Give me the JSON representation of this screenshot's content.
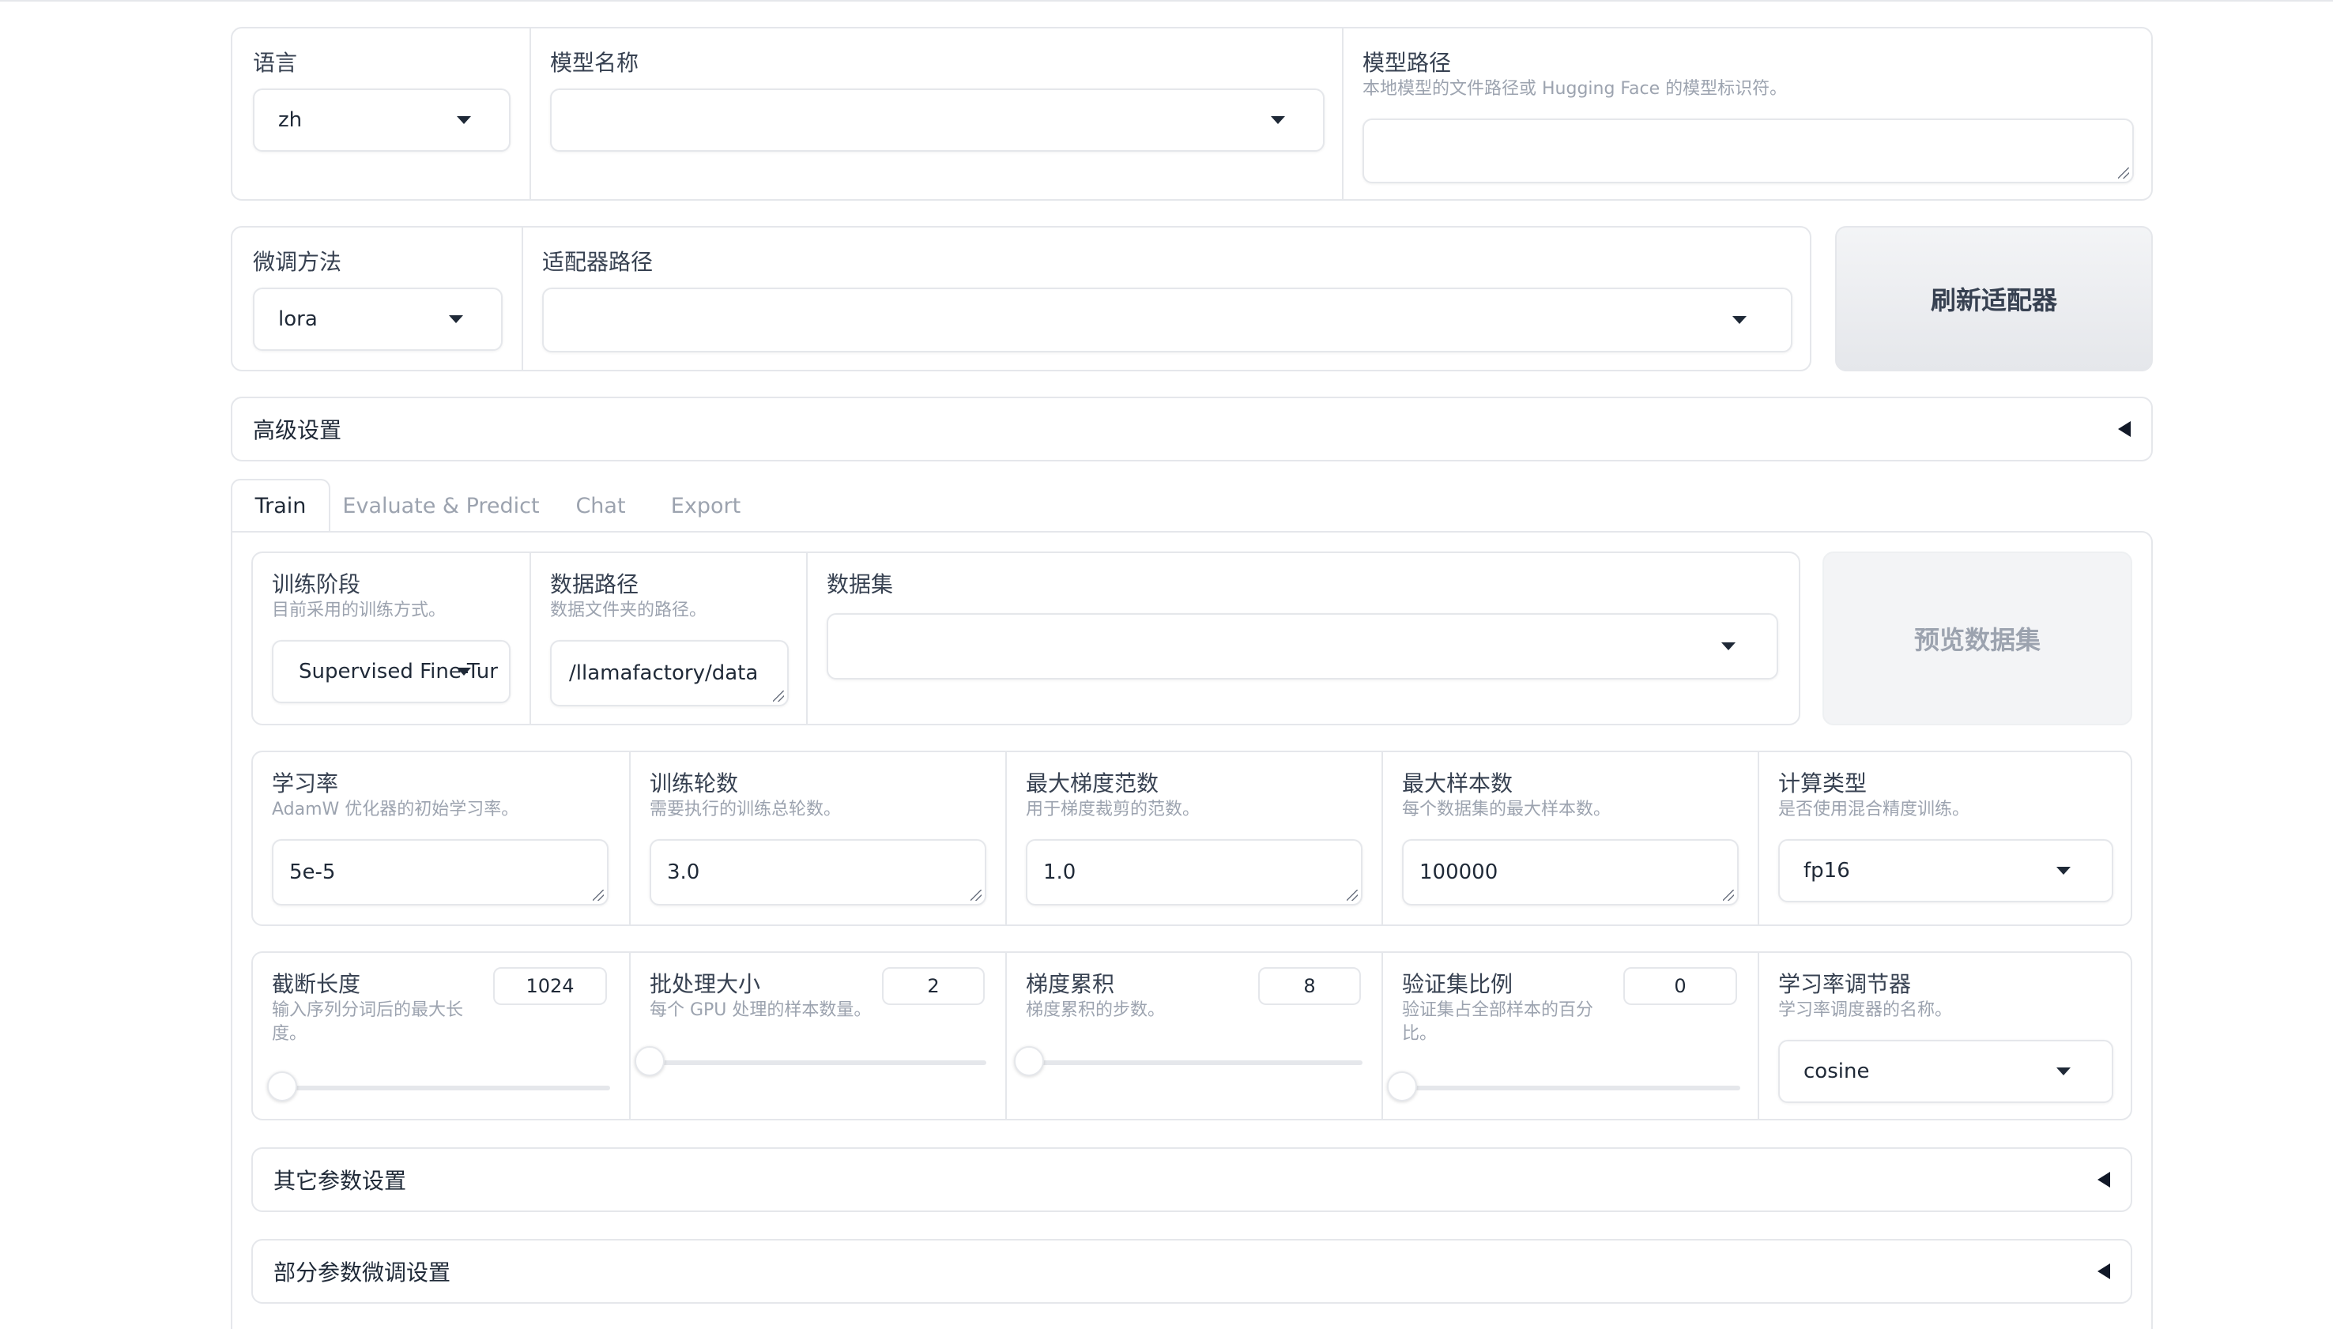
{
  "top": {
    "language": {
      "label": "语言",
      "value": "zh"
    },
    "model_name": {
      "label": "模型名称",
      "value": ""
    },
    "model_path": {
      "label": "模型路径",
      "info": "本地模型的文件路径或 Hugging Face 的模型标识符。",
      "value": ""
    }
  },
  "second": {
    "finetune": {
      "label": "微调方法",
      "value": "lora"
    },
    "adapter": {
      "label": "适配器路径",
      "value": ""
    },
    "refresh_button": "刷新适配器"
  },
  "advanced": {
    "title": "高级设置"
  },
  "tabs": [
    "Train",
    "Evaluate & Predict",
    "Chat",
    "Export"
  ],
  "active_tab": 0,
  "train": {
    "stage": {
      "label": "训练阶段",
      "info": "目前采用的训练方式。",
      "value": "Supervised Fine-Tur"
    },
    "data_dir": {
      "label": "数据路径",
      "info": "数据文件夹的路径。",
      "value": "/llamafactory/data"
    },
    "dataset": {
      "label": "数据集",
      "value": ""
    },
    "preview_button": "预览数据集",
    "row1": [
      {
        "label": "学习率",
        "info": "AdamW 优化器的初始学习率。",
        "value": "5e-5"
      },
      {
        "label": "训练轮数",
        "info": "需要执行的训练总轮数。",
        "value": "3.0"
      },
      {
        "label": "最大梯度范数",
        "info": "用于梯度裁剪的范数。",
        "value": "1.0"
      },
      {
        "label": "最大样本数",
        "info": "每个数据集的最大样本数。",
        "value": "100000"
      },
      {
        "label": "计算类型",
        "info": "是否使用混合精度训练。",
        "value": "fp16"
      }
    ],
    "row2": [
      {
        "label": "截断长度",
        "info": "输入序列分词后的最大长度。",
        "value": "1024",
        "fraction": 0.03
      },
      {
        "label": "批处理大小",
        "info": "每个 GPU 处理的样本数量。",
        "value": "2",
        "fraction": 0.0
      },
      {
        "label": "梯度累积",
        "info": "梯度累积的步数。",
        "value": "8",
        "fraction": 0.01
      },
      {
        "label": "验证集比例",
        "info": "验证集占全部样本的百分比。",
        "value": "0",
        "fraction": 0.0
      },
      {
        "label": "学习率调节器",
        "info": "学习率调度器的名称。",
        "value": "cosine"
      }
    ],
    "other_params": "其它参数设置",
    "partial_params": "部分参数微调设置"
  }
}
